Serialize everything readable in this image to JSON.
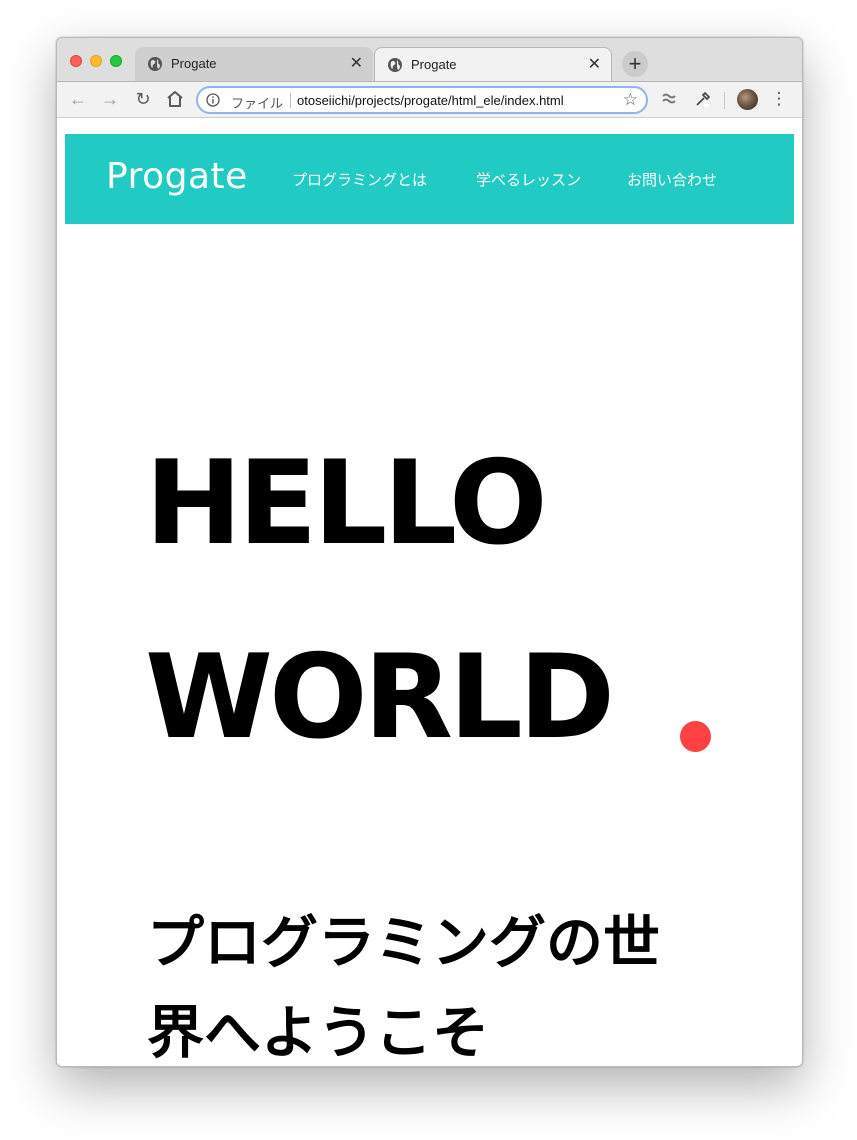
{
  "browser": {
    "tabs": [
      {
        "title": "Progate",
        "active": false
      },
      {
        "title": "Progate",
        "active": true
      }
    ],
    "new_tab": "+",
    "address_bar": {
      "scheme_label": "ファイル",
      "url": "otoseiichi/projects/progate/html_ele/index.html"
    },
    "icons": {
      "back": "arrow-left-icon",
      "forward": "arrow-right-icon",
      "reload": "reload-icon",
      "home": "home-icon",
      "info": "info-icon",
      "bookmark": "star-icon",
      "extension_1": "extension-icon",
      "extension_2": "eyedropper-icon",
      "profile": "avatar",
      "menu": "more-vert-icon"
    }
  },
  "site": {
    "logo": "Progate",
    "nav": [
      "プログラミングとは",
      "学べるレッスン",
      "お問い合わせ"
    ],
    "hero": {
      "line1": "HELLO",
      "line2": "WORLD",
      "dot_color": "#ff4141"
    },
    "subtitle": "プログラミングの世界へようこそ",
    "colors": {
      "header_bg": "#21cbc3",
      "header_text": "#ffffff"
    }
  }
}
